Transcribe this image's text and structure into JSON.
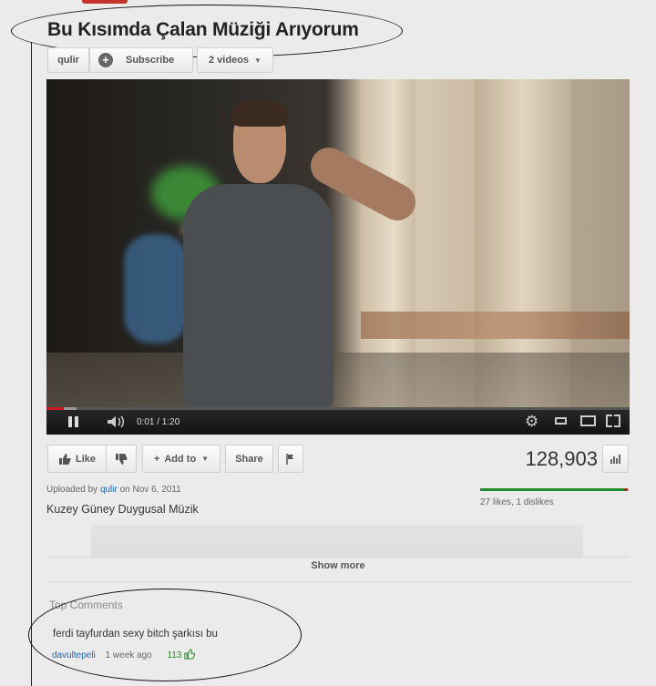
{
  "video": {
    "title": "Bu Kısımda Çalan Müziği Arıyorum",
    "views": "128,903"
  },
  "channel": {
    "name": "qulir",
    "subscribe_label": "Subscribe",
    "videos_label": "2 videos"
  },
  "player": {
    "time": "0:01 / 1:20",
    "progress_played_fraction": 0.03
  },
  "actions": {
    "like_label": "Like",
    "add_to_label": "Add to",
    "share_label": "Share"
  },
  "description": {
    "uploaded_prefix": "Uploaded by",
    "uploader": "qulir",
    "date_text": "on Nov 6, 2011",
    "text": "Kuzey Güney Duygusal Müzik",
    "likes_summary": "27 likes, 1 dislikes",
    "show_more_label": "Show more"
  },
  "comments": {
    "heading": "Top Comments",
    "items": [
      {
        "text": "ferdi tayfurdan sexy bitch şarkısı bu",
        "author": "davultepeli",
        "time": "1 week ago",
        "score": "113"
      }
    ]
  },
  "colors": {
    "brand_red": "#cc181e",
    "like_green": "#1d8d2b",
    "link_blue": "#1c62b9"
  }
}
